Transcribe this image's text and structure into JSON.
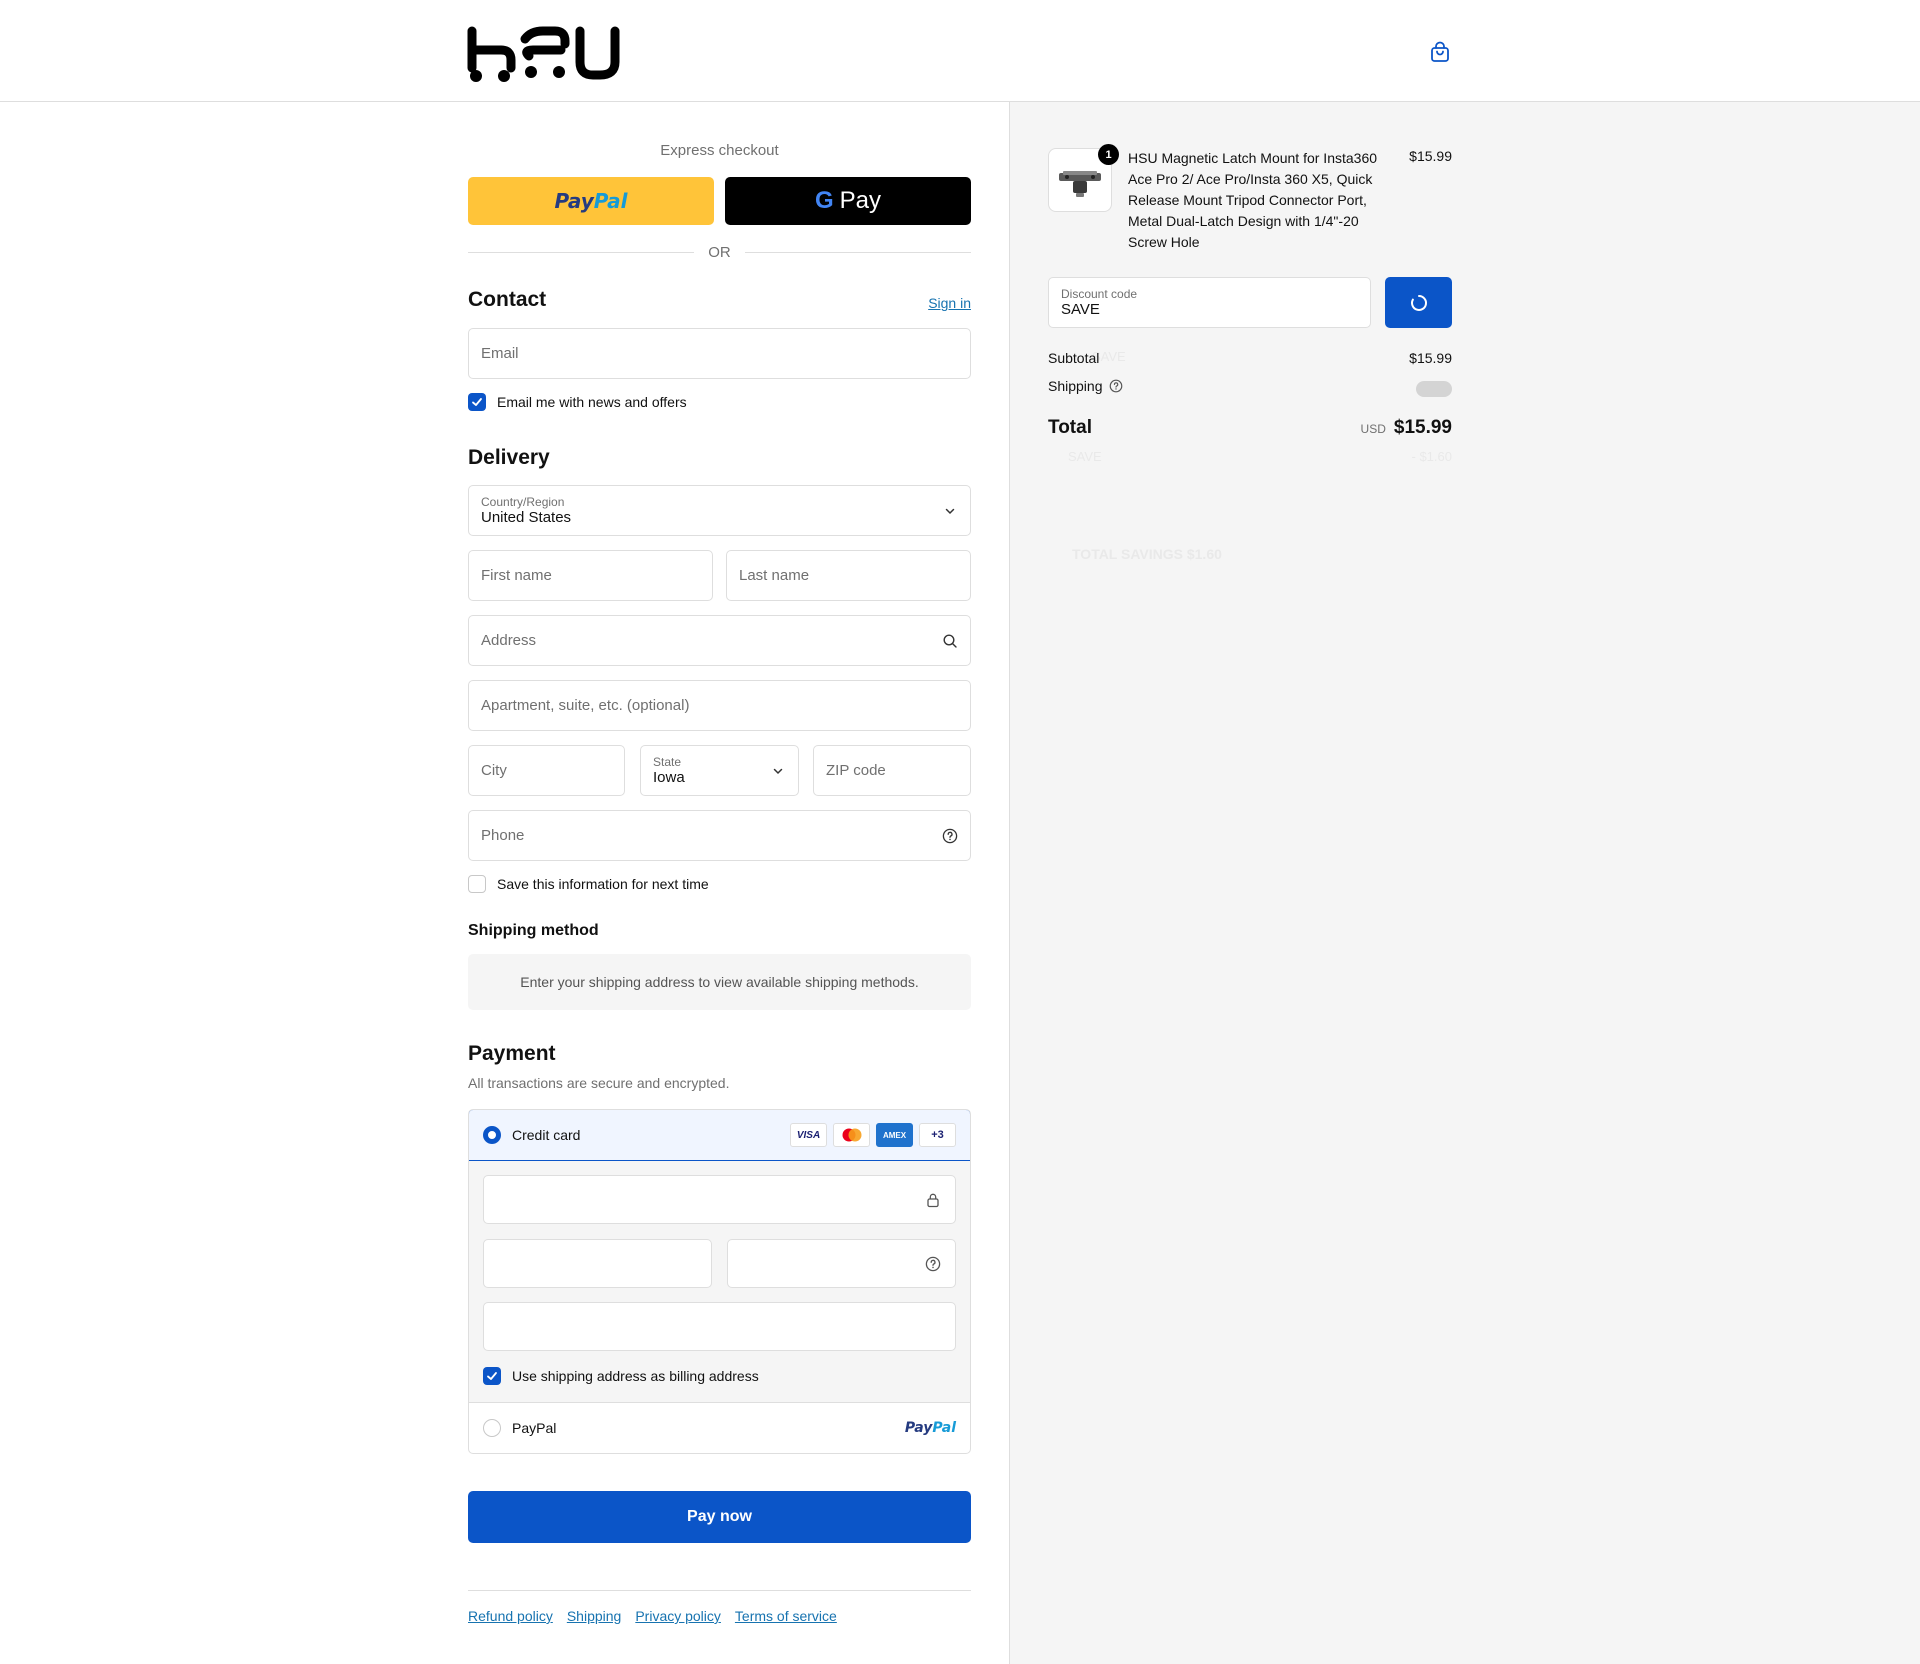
{
  "brand": {
    "logo_text": "hsu"
  },
  "header": {
    "cart_icon": "shopping-bag-icon"
  },
  "express": {
    "title": "Express checkout",
    "paypal_part1": "Pay",
    "paypal_part2": "Pal",
    "gpay_g": "G",
    "gpay_label": "Pay",
    "or_label": "OR"
  },
  "contact": {
    "title": "Contact",
    "signin_label": "Sign in",
    "email_placeholder": "Email",
    "newsletter_label": "Email me with news and offers",
    "newsletter_checked": true
  },
  "delivery": {
    "title": "Delivery",
    "country_label": "Country/Region",
    "country_value": "United States",
    "first_name_placeholder": "First name",
    "last_name_placeholder": "Last name",
    "address_placeholder": "Address",
    "apartment_placeholder": "Apartment, suite, etc. (optional)",
    "city_placeholder": "City",
    "state_label": "State",
    "state_value": "Iowa",
    "zip_placeholder": "ZIP code",
    "phone_placeholder": "Phone",
    "save_info_label": "Save this information for next time",
    "save_info_checked": false
  },
  "shipping_method": {
    "title": "Shipping method",
    "message": "Enter your shipping address to view available shipping methods."
  },
  "payment": {
    "title": "Payment",
    "subtitle": "All transactions are secure and encrypted.",
    "credit_card_label": "Credit card",
    "card_brands": [
      "VISA",
      "",
      "AMEX",
      "+3"
    ],
    "billing_same_label": "Use shipping address as billing address",
    "billing_same_checked": true,
    "paypal_label": "PayPal",
    "paypal_logo_part1": "Pay",
    "paypal_logo_part2": "Pal",
    "pay_now_label": "Pay now"
  },
  "footer": {
    "links": [
      "Refund policy",
      "Shipping",
      "Privacy policy",
      "Terms of service"
    ]
  },
  "summary": {
    "quantity": "1",
    "product_name": "HSU Magnetic Latch Mount for Insta360 Ace Pro 2/ Ace Pro/Insta 360 X5, Quick Release Mount Tripod Connector Port, Metal Dual-Latch Design with 1/4\"-20 Screw Hole",
    "product_price": "$15.99",
    "discount_label": "Discount code",
    "discount_value": "SAVE",
    "subtotal_label": "Subtotal",
    "subtotal_value": "$15.99",
    "shipping_label": "Shipping",
    "total_label": "Total",
    "currency": "USD",
    "total_value": "$15.99",
    "ghost_tag": "SAVE",
    "ghost_savings": "TOTAL SAVINGS $1.60",
    "ghost_discount_value": "- $1.60"
  },
  "colors": {
    "accent": "#0b55c8",
    "link": "#1773b0",
    "paypal_yellow": "#ffc439",
    "summary_bg": "#f5f5f5"
  }
}
